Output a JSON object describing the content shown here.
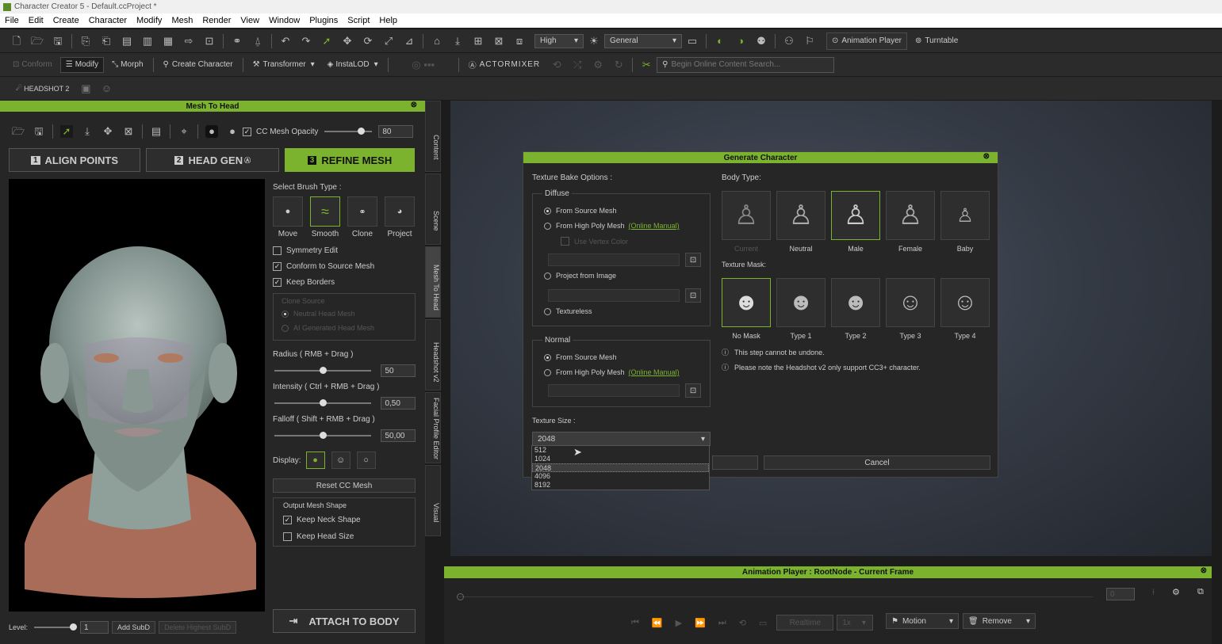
{
  "window": {
    "title": "Character Creator 5 - Default.ccProject *"
  },
  "menu": [
    "File",
    "Edit",
    "Create",
    "Character",
    "Modify",
    "Mesh",
    "Render",
    "View",
    "Window",
    "Plugins",
    "Script",
    "Help"
  ],
  "toolbar1": {
    "quality": "High",
    "render_mode": "General",
    "animation_player": "Animation Player",
    "turntable": "Turntable"
  },
  "toolbar2": {
    "conform": "Conform",
    "modify": "Modify",
    "morph": "Morph",
    "create_character": "Create Character",
    "transformer": "Transformer",
    "instalod": "InstaLOD",
    "actormixer": "ACTORMIXER",
    "search_placeholder": "Begin Online Content Search..."
  },
  "toolbar3": {
    "headshot": "HEADSHOT 2"
  },
  "mesh_panel": {
    "title": "Mesh To Head",
    "opacity_label": "CC Mesh Opacity",
    "opacity_value": "80",
    "tabs": [
      {
        "num": "1",
        "label": "ALIGN POINTS"
      },
      {
        "num": "2",
        "label": "HEAD GEN"
      },
      {
        "num": "3",
        "label": "REFINE MESH"
      }
    ],
    "brush_type_label": "Select Brush Type :",
    "brushes": [
      "Move",
      "Smooth",
      "Clone",
      "Project"
    ],
    "symmetry": "Symmetry Edit",
    "conform": "Conform to Source Mesh",
    "keep_borders": "Keep Borders",
    "clone_source": "Clone Source",
    "neutral": "Neutral Head Mesh",
    "ai": "AI Generated Head Mesh",
    "radius_label": "Radius ( RMB + Drag )",
    "radius_value": "50",
    "radius_pct": 0.5,
    "intensity_label": "Intensity ( Ctrl + RMB + Drag )",
    "intensity_value": "0,50",
    "intensity_pct": 0.5,
    "falloff_label": "Falloff ( Shift + RMB + Drag )",
    "falloff_value": "50,00",
    "falloff_pct": 0.5,
    "display_label": "Display:",
    "reset": "Reset CC Mesh",
    "output_label": "Output Mesh Shape",
    "keep_neck": "Keep Neck Shape",
    "keep_head": "Keep Head Size",
    "level_label": "Level:",
    "level_value": "1",
    "add_subd": "Add SubD",
    "delete_subd": "Delete Highest SubD",
    "attach": "ATTACH TO BODY"
  },
  "side_tabs": [
    "Content",
    "Scene",
    "Mesh To Head",
    "Headshot v2",
    "Facial Profile Editor",
    "Visual"
  ],
  "dialog": {
    "title": "Generate Character",
    "bake_label": "Texture Bake Options :",
    "diffuse": "Diffuse",
    "from_source": "From Source Mesh",
    "from_high": "From High Poly Mesh",
    "online_manual": "(Online Manual)",
    "use_vertex": "Use Vertex Color",
    "project_image": "Project from Image",
    "textureless": "Textureless",
    "normal": "Normal",
    "n_from_source": "From Source Mesh",
    "n_from_high": "From High Poly Mesh",
    "n_online_manual": "(Online Manual)",
    "texture_size_label": "Texture Size :",
    "texture_size": "2048",
    "size_options": [
      "512",
      "1024",
      "2048",
      "4096",
      "8192"
    ],
    "body_type_label": "Body Type:",
    "body_types": [
      "Current",
      "Neutral",
      "Male",
      "Female",
      "Baby"
    ],
    "mask_label": "Texture Mask:",
    "masks": [
      "No Mask",
      "Type 1",
      "Type 2",
      "Type 3",
      "Type 4"
    ],
    "note1": "This step cannot be undone.",
    "note2": "Please note the Headshot v2 only support CC3+ character.",
    "cancel": "Cancel"
  },
  "anim_player": {
    "title": "Animation Player : RootNode - Current Frame",
    "time": "0",
    "realtime": "Realtime",
    "speed": "1x",
    "motion": "Motion",
    "remove": "Remove"
  },
  "colors": {
    "accent": "#7bb32e"
  }
}
